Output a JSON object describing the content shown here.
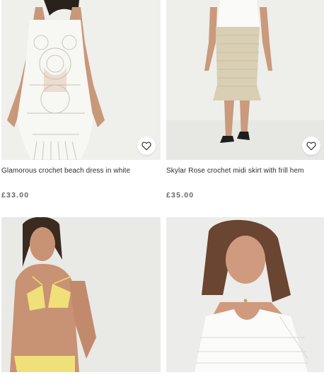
{
  "products": [
    {
      "title": "Glamorous crochet beach dress in white",
      "price": "£33.00"
    },
    {
      "title": "Skylar Rose crochet midi skirt with frill hem",
      "price": "£35.00"
    },
    {
      "title": "",
      "price": ""
    },
    {
      "title": "",
      "price": ""
    }
  ],
  "icons": {
    "wishlist": "heart-outline-icon"
  },
  "colors": {
    "text": "#2d2d2d",
    "price": "#666666",
    "photo_bg": "#eeeeec"
  }
}
